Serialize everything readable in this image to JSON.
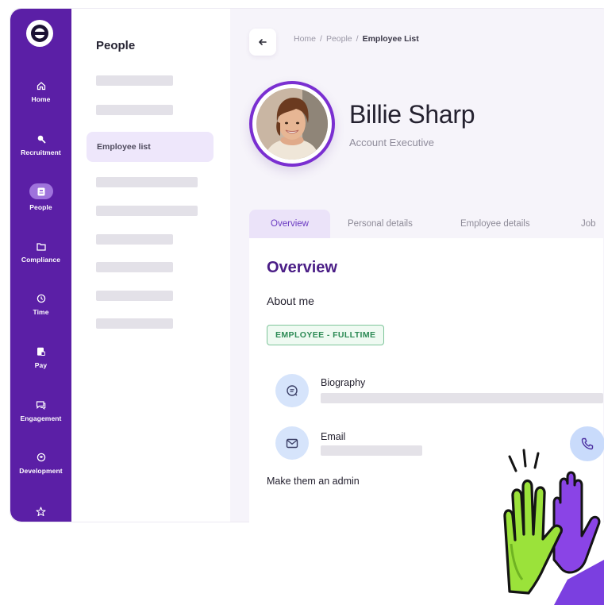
{
  "rail": {
    "items": [
      {
        "label": "Home",
        "icon": "home-icon"
      },
      {
        "label": "Recruitment",
        "icon": "search-icon"
      },
      {
        "label": "People",
        "icon": "people-icon",
        "active": true
      },
      {
        "label": "Compliance",
        "icon": "folder-icon"
      },
      {
        "label": "Time",
        "icon": "clock-icon"
      },
      {
        "label": "Pay",
        "icon": "pay-icon"
      },
      {
        "label": "Engagement",
        "icon": "chat-icon"
      },
      {
        "label": "Development",
        "icon": "graduation-icon"
      },
      {
        "label": "",
        "icon": "star-icon"
      }
    ]
  },
  "subnav": {
    "title": "People",
    "active_item": "Employee list"
  },
  "breadcrumb": {
    "home": "Home",
    "people": "People",
    "current": "Employee List",
    "separator": "/"
  },
  "profile": {
    "name": "Billie Sharp",
    "role": "Account Executive"
  },
  "tabs": [
    "Overview",
    "Personal details",
    "Employee details",
    "Job"
  ],
  "overview": {
    "title": "Overview",
    "about_label": "About me",
    "badge": "EMPLOYEE - FULLTIME",
    "biography_label": "Biography",
    "email_label": "Email",
    "admin_label": "Make them an admin"
  },
  "colors": {
    "brand_purple": "#5b1fa6",
    "accent_purple": "#7a2fd1",
    "badge_green": "#2c8a55",
    "icon_bg_blue": "#d6e4fb",
    "hand_green": "#9be23a"
  }
}
